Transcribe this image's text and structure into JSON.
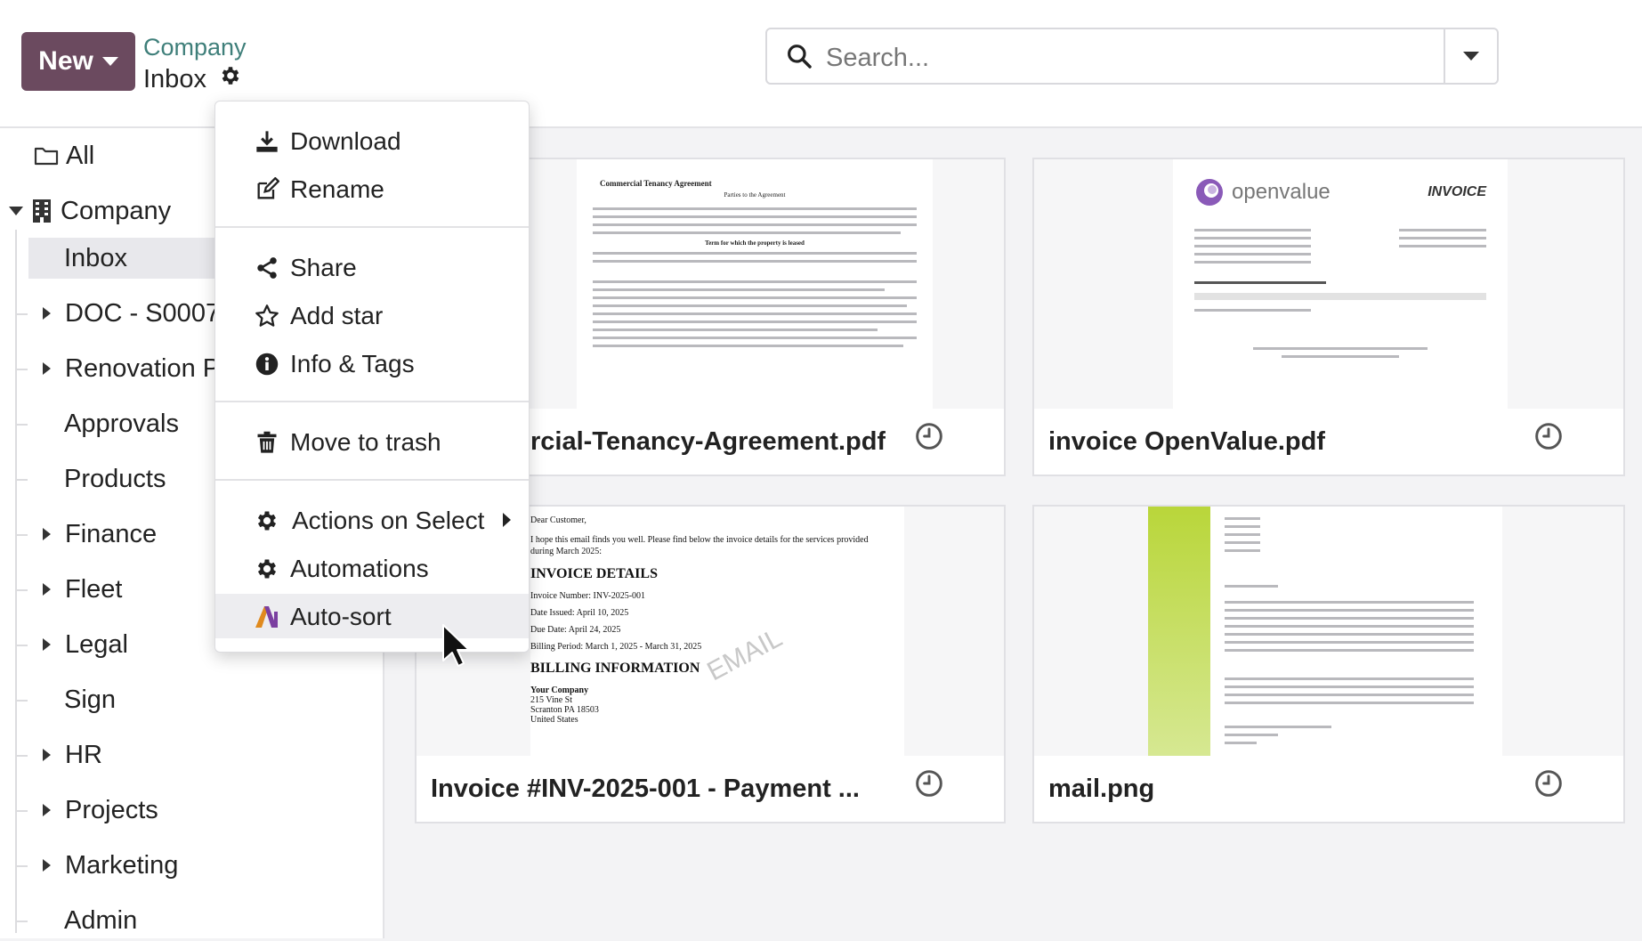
{
  "header": {
    "new_label": "New",
    "breadcrumb_parent": "Company",
    "breadcrumb_current": "Inbox",
    "search_placeholder": "Search..."
  },
  "sidebar": {
    "items": [
      {
        "label": "All"
      },
      {
        "label": "Company"
      },
      {
        "label": "Inbox"
      },
      {
        "label": "DOC - S0007"
      },
      {
        "label": "Renovation P"
      },
      {
        "label": "Approvals"
      },
      {
        "label": "Products"
      },
      {
        "label": "Finance"
      },
      {
        "label": "Fleet"
      },
      {
        "label": "Legal"
      },
      {
        "label": "Sign"
      },
      {
        "label": "HR"
      },
      {
        "label": "Projects"
      },
      {
        "label": "Marketing"
      },
      {
        "label": "Admin"
      }
    ]
  },
  "documents": [
    {
      "name": "rcial-Tenancy-Agreement.pdf",
      "preview": {
        "title": "Commercial Tenancy Agreement",
        "subtitle": "Parties to the Agreement",
        "section": "Term for which the property is leased"
      }
    },
    {
      "name": "invoice OpenValue.pdf",
      "preview": {
        "logo": "openvalue",
        "heading": "INVOICE"
      }
    },
    {
      "name": "Invoice #INV-2025-001 - Payment ...",
      "preview": {
        "greeting": "Dear Customer,",
        "intro": "I hope this email finds you well. Please find below the invoice details for the services provided during March 2025:",
        "h1": "INVOICE DETAILS",
        "l1": "Invoice Number: INV-2025-001",
        "l2": "Date Issued: April 10, 2025",
        "l3": "Due Date: April 24, 2025",
        "l4": "Billing Period: March 1, 2025 - March 31, 2025",
        "h2": "BILLING INFORMATION",
        "a1": "Your Company",
        "a2": "215 Vine St",
        "a3": "Scranton PA 18503",
        "a4": "United States",
        "watermark": "EMAIL"
      }
    },
    {
      "name": "mail.png",
      "preview": {}
    }
  ],
  "menu": {
    "download": "Download",
    "rename": "Rename",
    "share": "Share",
    "add_star": "Add star",
    "info_tags": "Info & Tags",
    "move_trash": "Move to trash",
    "actions_select": "Actions on Select",
    "automations": "Automations",
    "auto_sort": "Auto-sort"
  },
  "colors": {
    "primary": "#6b4a5f",
    "breadcrumb": "#3f7f7a",
    "auto_sort_icon": [
      "#e08a1e",
      "#7b3fa0"
    ]
  },
  "icons": {
    "gear": "gear-icon",
    "search": "search-icon",
    "clock": "clock-icon",
    "folder": "folder-icon",
    "building": "building-icon"
  }
}
